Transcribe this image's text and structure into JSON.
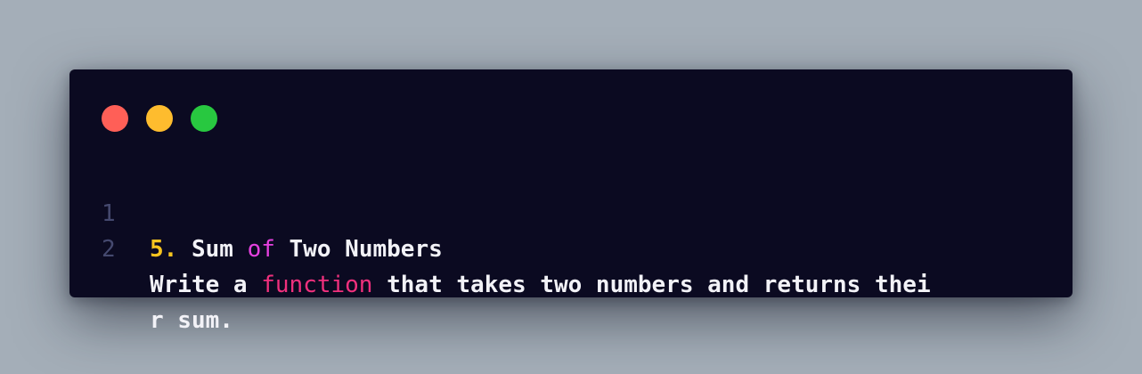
{
  "colors": {
    "background": "#a4aeb8",
    "window": "#0b0a21",
    "dot_red": "#ff5f57",
    "dot_yellow": "#febc2e",
    "dot_green": "#28c840",
    "line_number": "#45496f",
    "text": "#f2f2f7",
    "number_token": "#f7c41f",
    "keyword_of": "#e641e0",
    "keyword_function": "#f0307d"
  },
  "editor": {
    "lines": [
      {
        "number": "1",
        "tokens": {
          "t1": "5.",
          "t2": " Sum ",
          "t3": "of",
          "t4": " Two Numbers"
        }
      },
      {
        "number": "2",
        "tokens": {
          "t1": "Write a ",
          "t2": "function",
          "t3": " that takes two numbers and returns thei"
        }
      },
      {
        "number": "",
        "tokens": {
          "t1": "r sum."
        }
      }
    ]
  }
}
